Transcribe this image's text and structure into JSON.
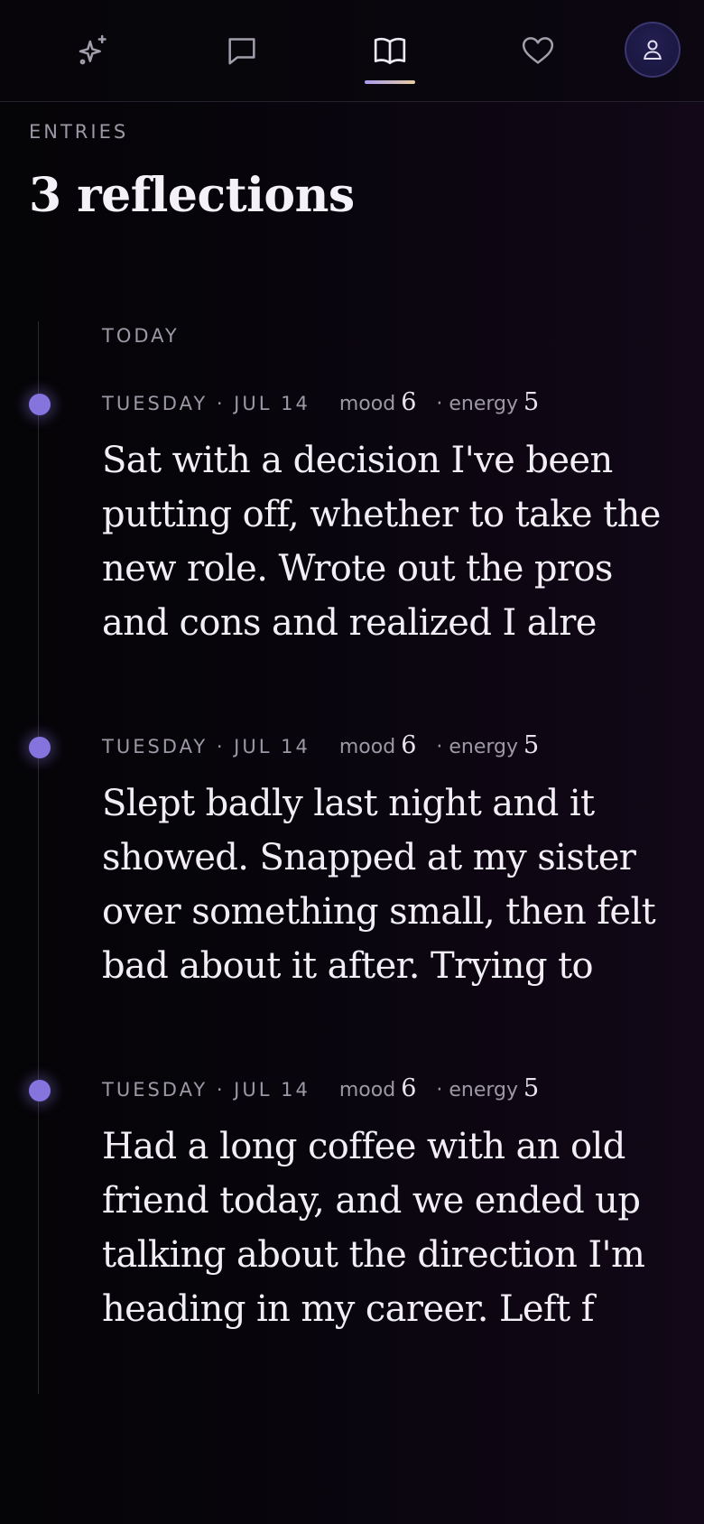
{
  "nav": {
    "tabs": [
      {
        "icon": "sparkle-icon",
        "active": false
      },
      {
        "icon": "chat-bubble-icon",
        "active": false
      },
      {
        "icon": "open-book-icon",
        "active": true
      },
      {
        "icon": "heart-icon",
        "active": false
      }
    ],
    "profile_icon": "user-icon"
  },
  "header": {
    "eyebrow": "ENTRIES",
    "title": "3 reflections"
  },
  "timeline": {
    "group_label": "TODAY",
    "mood_label": "mood",
    "energy_label": "· energy",
    "entries": [
      {
        "date": "TUESDAY · JUL 14",
        "mood": "6",
        "energy": "5",
        "excerpt": "Sat with a decision I've been putting off, whether to take the new role. Wrote out the pros and cons and realized I alre"
      },
      {
        "date": "TUESDAY · JUL 14",
        "mood": "6",
        "energy": "5",
        "excerpt": "Slept badly last night and it showed. Snapped at my sister over something small, then felt bad about it after. Trying to"
      },
      {
        "date": "TUESDAY · JUL 14",
        "mood": "6",
        "energy": "5",
        "excerpt": "Had a long coffee with an old friend today, and we ended up talking about the direction I'm heading in my career. Left f"
      }
    ]
  },
  "colors": {
    "accent": "#8674de",
    "indicator_start": "#a99bf0",
    "indicator_end": "#e8cda0",
    "muted_text": "#9c98a6"
  }
}
